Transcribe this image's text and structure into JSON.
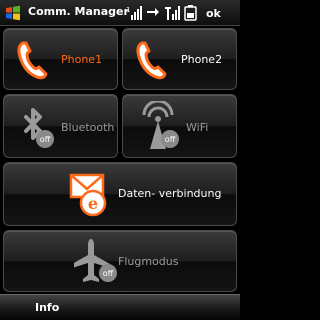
{
  "titlebar": {
    "title": "Comm. Manager",
    "ok_label": "ok"
  },
  "tiles": {
    "phone1": {
      "label": "Phone1",
      "state": "on",
      "label_color": "#ff6a1a"
    },
    "phone2": {
      "label": "Phone2",
      "state": "on",
      "label_color": "#ffffff"
    },
    "bluetooth": {
      "label": "Bluetooth",
      "state": "off",
      "badge": "off"
    },
    "wifi": {
      "label": "WiFi",
      "state": "off",
      "badge": "off"
    },
    "data": {
      "label": "Daten- verbindung",
      "state": "on"
    },
    "flight": {
      "label": "Flugmodus",
      "state": "off",
      "badge": "off"
    }
  },
  "menubar": {
    "left_softkey": "Info"
  },
  "colors": {
    "accent": "#ff7a1a",
    "disabled_gray": "#8a8a8a",
    "background": "#000000"
  },
  "icons": {
    "start": "windows-flag-icon",
    "signal1": "signal-icon",
    "sync": "sync-arrows-icon",
    "signal2": "signal-2-icon",
    "battery": "battery-icon"
  }
}
